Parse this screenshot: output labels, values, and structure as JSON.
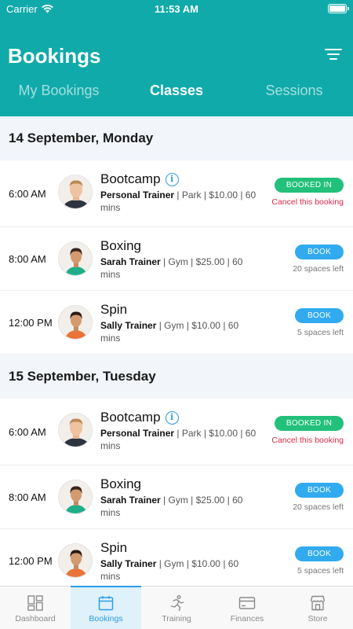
{
  "status_bar": {
    "carrier": "Carrier",
    "time": "11:53 AM"
  },
  "header": {
    "title": "Bookings",
    "filter_icon": "filter-icon"
  },
  "tabs": [
    {
      "label": "My Bookings",
      "active": false
    },
    {
      "label": "Classes",
      "active": true
    },
    {
      "label": "Sessions",
      "active": false
    }
  ],
  "days": [
    {
      "date": "14 September, Monday",
      "sessions": [
        {
          "time": "6:00 AM",
          "name": "Bootcamp",
          "info_icon": true,
          "trainer": "Personal Trainer",
          "details": " | Park | $10.00 | 60 mins",
          "button": "BOOKED IN",
          "status": "booked",
          "sub": "Cancel this booking",
          "avatar": "man"
        },
        {
          "time": "8:00 AM",
          "name": "Boxing",
          "info_icon": false,
          "trainer": "Sarah Trainer",
          "details": " | Gym | $25.00 | 60 mins",
          "button": "BOOK",
          "status": "open",
          "sub": "20 spaces left",
          "avatar": "woman-green"
        },
        {
          "time": "12:00 PM",
          "name": "Spin",
          "info_icon": false,
          "trainer": "Sally Trainer",
          "details": " | Gym | $10.00 | 60 mins",
          "button": "BOOK",
          "status": "open",
          "sub": "5 spaces left",
          "avatar": "woman-orange"
        }
      ]
    },
    {
      "date": "15 September, Tuesday",
      "sessions": [
        {
          "time": "6:00 AM",
          "name": "Bootcamp",
          "info_icon": true,
          "trainer": "Personal Trainer",
          "details": " | Park | $10.00 | 60 mins",
          "button": "BOOKED IN",
          "status": "booked",
          "sub": "Cancel this booking",
          "avatar": "man"
        },
        {
          "time": "8:00 AM",
          "name": "Boxing",
          "info_icon": false,
          "trainer": "Sarah Trainer",
          "details": " | Gym | $25.00 | 60 mins",
          "button": "BOOK",
          "status": "open",
          "sub": "20 spaces left",
          "avatar": "woman-green"
        },
        {
          "time": "12:00 PM",
          "name": "Spin",
          "info_icon": false,
          "trainer": "Sally Trainer",
          "details": " | Gym | $10.00 | 60 mins",
          "button": "BOOK",
          "status": "open",
          "sub": "5 spaces left",
          "avatar": "woman-orange"
        }
      ]
    }
  ],
  "bottom_nav": [
    {
      "label": "Dashboard",
      "icon": "dashboard-icon",
      "active": false
    },
    {
      "label": "Bookings",
      "icon": "calendar-icon",
      "active": true
    },
    {
      "label": "Training",
      "icon": "running-icon",
      "active": false
    },
    {
      "label": "Finances",
      "icon": "credit-card-icon",
      "active": false
    },
    {
      "label": "Store",
      "icon": "store-icon",
      "active": false
    }
  ],
  "colors": {
    "primary": "#10aaaa",
    "booked": "#22c07a",
    "book": "#31aaf0",
    "cancel": "#e0284a",
    "active_nav": "#2b9de8"
  }
}
